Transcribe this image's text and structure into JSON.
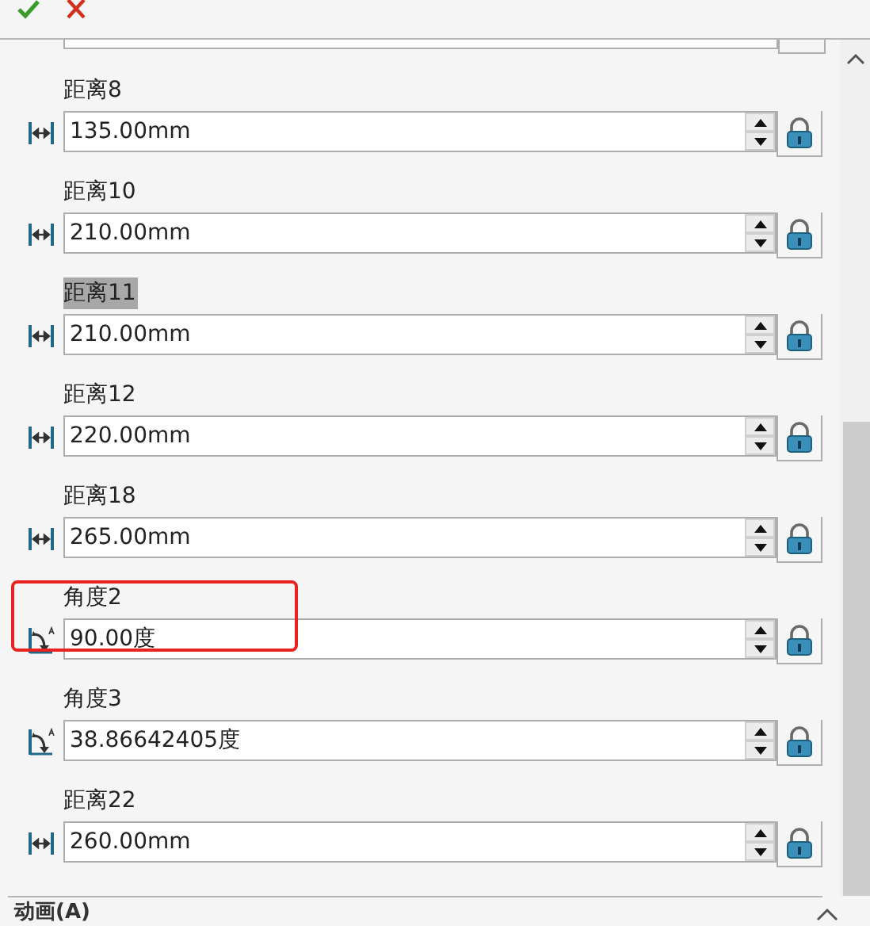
{
  "toolbar": {
    "buttons": [
      {
        "kind": "ok"
      },
      {
        "kind": "cancel"
      }
    ]
  },
  "parameters": [
    {
      "label": "距离8",
      "value": "135.00mm",
      "kind": "distance",
      "selected": false,
      "marked": false
    },
    {
      "label": "距离10",
      "value": "210.00mm",
      "kind": "distance",
      "selected": false,
      "marked": false
    },
    {
      "label": "距离11",
      "value": "210.00mm",
      "kind": "distance",
      "selected": true,
      "marked": false
    },
    {
      "label": "距离12",
      "value": "220.00mm",
      "kind": "distance",
      "selected": false,
      "marked": false
    },
    {
      "label": "距离18",
      "value": "265.00mm",
      "kind": "distance",
      "selected": false,
      "marked": false
    },
    {
      "label": "角度2",
      "value": "90.00度",
      "kind": "angle",
      "selected": false,
      "marked": true
    },
    {
      "label": "角度3",
      "value": "38.86642405度",
      "kind": "angle",
      "selected": false,
      "marked": false
    },
    {
      "label": "距离22",
      "value": "260.00mm",
      "kind": "distance",
      "selected": false,
      "marked": false
    }
  ],
  "section": {
    "title": "动画(A)",
    "expanded": true
  }
}
